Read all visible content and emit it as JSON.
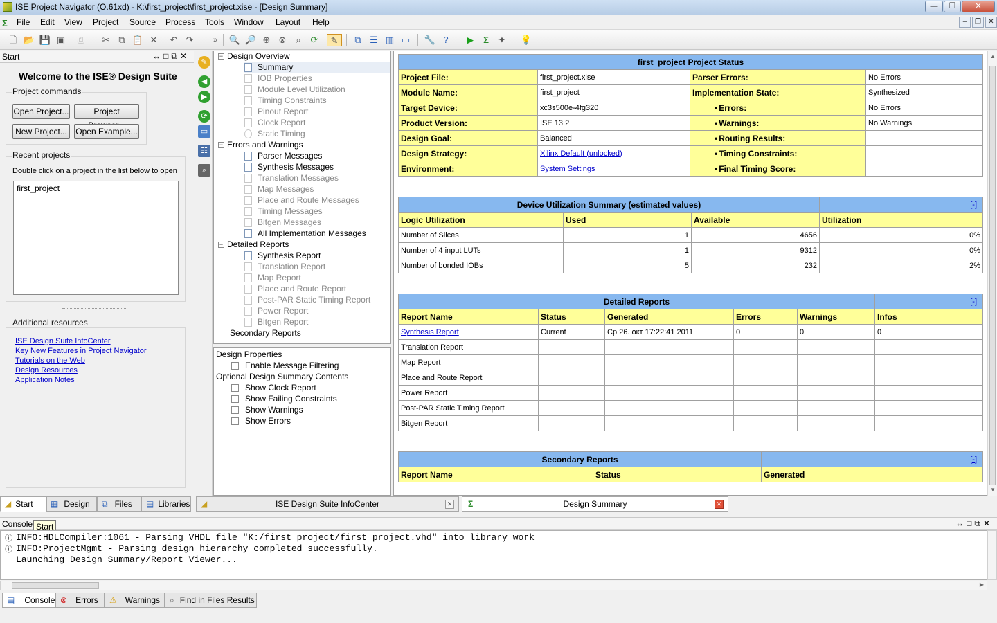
{
  "window": {
    "title": "ISE Project Navigator (O.61xd) - K:\\first_project\\first_project.xise - [Design Summary]"
  },
  "menu": [
    "File",
    "Edit",
    "View",
    "Project",
    "Source",
    "Process",
    "Tools",
    "Window",
    "Layout",
    "Help"
  ],
  "start_panel": {
    "header": "Start",
    "welcome": "Welcome to the ISE® Design Suite",
    "project_commands": "Project commands",
    "buttons": {
      "open_project": "Open Project...",
      "project_browser": "Project Browser...",
      "new_project": "New Project...",
      "open_example": "Open Example..."
    },
    "recent_title": "Recent projects",
    "recent_hint": "Double click on a project in the list below to open",
    "recent_items": [
      "first_project"
    ],
    "additional_title": "Additional resources",
    "links": [
      "ISE Design Suite InfoCenter",
      "Key New Features in Project Navigator",
      "Tutorials on the Web",
      "Design Resources",
      "Application Notes"
    ]
  },
  "left_tabs": [
    "Start",
    "Design",
    "Files",
    "Libraries"
  ],
  "tree": {
    "design_overview": "Design Overview",
    "overview_items": [
      "Summary",
      "IOB Properties",
      "Module Level Utilization",
      "Timing Constraints",
      "Pinout Report",
      "Clock Report",
      "Static Timing"
    ],
    "errors_warnings": "Errors and Warnings",
    "ew_items": [
      "Parser Messages",
      "Synthesis Messages",
      "Translation Messages",
      "Map Messages",
      "Place and Route Messages",
      "Timing Messages",
      "Bitgen Messages",
      "All Implementation Messages"
    ],
    "detailed_reports": "Detailed Reports",
    "dr_items": [
      "Synthesis Report",
      "Translation Report",
      "Map Report",
      "Place and Route Report",
      "Post-PAR Static Timing Report",
      "Power Report",
      "Bitgen Report"
    ],
    "secondary_reports": "Secondary Reports"
  },
  "props": {
    "design_properties": "Design Properties",
    "enable_filtering": "Enable Message Filtering",
    "optional_contents": "Optional Design Summary Contents",
    "options": [
      "Show Clock Report",
      "Show Failing Constraints",
      "Show Warnings",
      "Show Errors"
    ]
  },
  "status_table": {
    "title": "first_project Project Status",
    "rows": [
      {
        "l": "Project File:",
        "v": "first_project.xise",
        "l2": "Parser Errors:",
        "v2": "No Errors"
      },
      {
        "l": "Module Name:",
        "v": "first_project",
        "l2": "Implementation State:",
        "v2": "Synthesized"
      },
      {
        "l": "Target Device:",
        "v": "xc3s500e-4fg320",
        "l2": "Errors:",
        "v2": "No Errors"
      },
      {
        "l": "Product Version:",
        "v": "ISE 13.2",
        "l2": "Warnings:",
        "v2": "No Warnings"
      },
      {
        "l": "Design Goal:",
        "v": "Balanced",
        "l2": "Routing Results:",
        "v2": ""
      },
      {
        "l": "Design Strategy:",
        "v": "Xilinx Default (unlocked)",
        "l2": "Timing Constraints:",
        "v2": ""
      },
      {
        "l": "Environment:",
        "v": "System Settings",
        "l2": "Final Timing Score:",
        "v2": ""
      }
    ]
  },
  "util_table": {
    "title": "Device Utilization Summary (estimated values)",
    "toggle": "[-]",
    "headers": [
      "Logic Utilization",
      "Used",
      "Available",
      "Utilization"
    ],
    "rows": [
      [
        "Number of Slices",
        "1",
        "4656",
        "0%"
      ],
      [
        "Number of 4 input LUTs",
        "1",
        "9312",
        "0%"
      ],
      [
        "Number of bonded IOBs",
        "5",
        "232",
        "2%"
      ]
    ]
  },
  "detailed_table": {
    "title": "Detailed Reports",
    "toggle": "[-]",
    "headers": [
      "Report Name",
      "Status",
      "Generated",
      "Errors",
      "Warnings",
      "Infos"
    ],
    "rows": [
      [
        "Synthesis Report",
        "Current",
        "Ср 26. окт 17:22:41 2011",
        "0",
        "0",
        "0"
      ],
      [
        "Translation Report",
        "",
        "",
        "",
        "",
        ""
      ],
      [
        "Map Report",
        "",
        "",
        "",
        "",
        ""
      ],
      [
        "Place and Route Report",
        "",
        "",
        "",
        "",
        ""
      ],
      [
        "Power Report",
        "",
        "",
        "",
        "",
        ""
      ],
      [
        "Post-PAR Static Timing Report",
        "",
        "",
        "",
        "",
        ""
      ],
      [
        "Bitgen Report",
        "",
        "",
        "",
        "",
        ""
      ]
    ]
  },
  "secondary_table": {
    "title": "Secondary Reports",
    "toggle": "[-]",
    "headers": [
      "Report Name",
      "Status",
      "Generated"
    ]
  },
  "editor_tabs": [
    "ISE Design Suite InfoCenter",
    "Design Summary"
  ],
  "console": {
    "header": "Console",
    "lines": [
      "INFO:HDLCompiler:1061 - Parsing VHDL file \"K:/first_project/first_project.vhd\" into library work",
      "INFO:ProjectMgmt - Parsing design hierarchy completed successfully.",
      "Launching Design Summary/Report Viewer..."
    ]
  },
  "console_tabs": [
    "Console",
    "Errors",
    "Warnings",
    "Find in Files Results"
  ],
  "tooltip": "Start"
}
